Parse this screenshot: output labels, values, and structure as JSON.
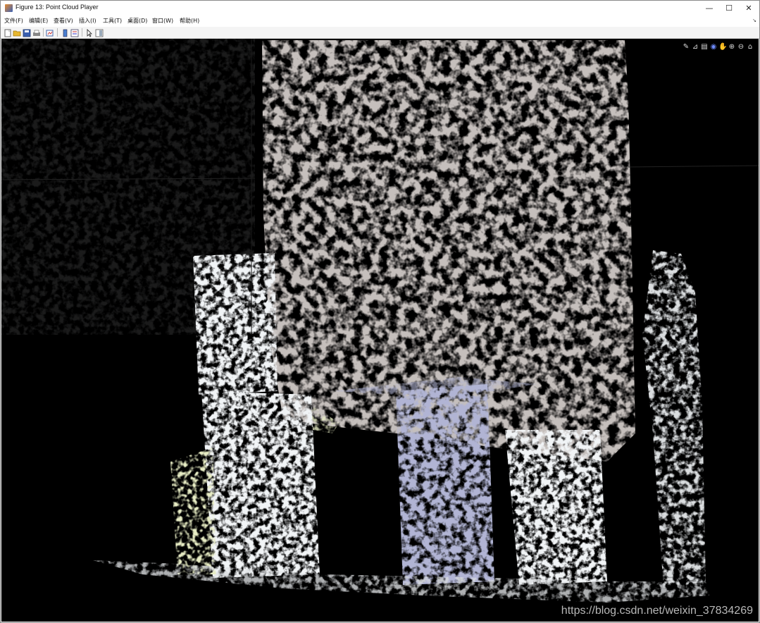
{
  "window": {
    "title": "Figure 13: Point Cloud Player",
    "controls": {
      "minimize": "—",
      "maximize": "☐",
      "close": "✕"
    }
  },
  "menubar": {
    "items": [
      "文件(F)",
      "编辑(E)",
      "查看(V)",
      "插入(I)",
      "工具(T)",
      "桌面(D)",
      "窗口(W)",
      "帮助(H)"
    ],
    "overflow": "↘"
  },
  "toolbar": {
    "buttons": [
      "new-figure-icon",
      "open-icon",
      "save-icon",
      "print-icon",
      "link-plot-icon",
      "colorbar-icon",
      "legend-icon",
      "edit-plot-icon",
      "property-inspector-icon"
    ]
  },
  "axes_toolbar": {
    "buttons": [
      {
        "icon": "brush-icon",
        "glyph": "✎"
      },
      {
        "icon": "data-tips-icon",
        "glyph": "⊿"
      },
      {
        "icon": "color-bar-icon",
        "glyph": "▤"
      },
      {
        "icon": "rotate-icon",
        "glyph": "◉"
      },
      {
        "icon": "pan-icon",
        "glyph": "✋"
      },
      {
        "icon": "zoom-in-icon",
        "glyph": "⊕"
      },
      {
        "icon": "zoom-out-icon",
        "glyph": "⊖"
      },
      {
        "icon": "home-icon",
        "glyph": "⌂"
      }
    ]
  },
  "colors": {
    "background": "#000000",
    "wall": "#8a7f7a",
    "box_white": "#dfe3e6",
    "box_blue": "#6f74a3",
    "box_green": "#c9d48a",
    "accent_rotate": "#6f8cff"
  },
  "watermark": "https://blog.csdn.net/weixin_37834269"
}
